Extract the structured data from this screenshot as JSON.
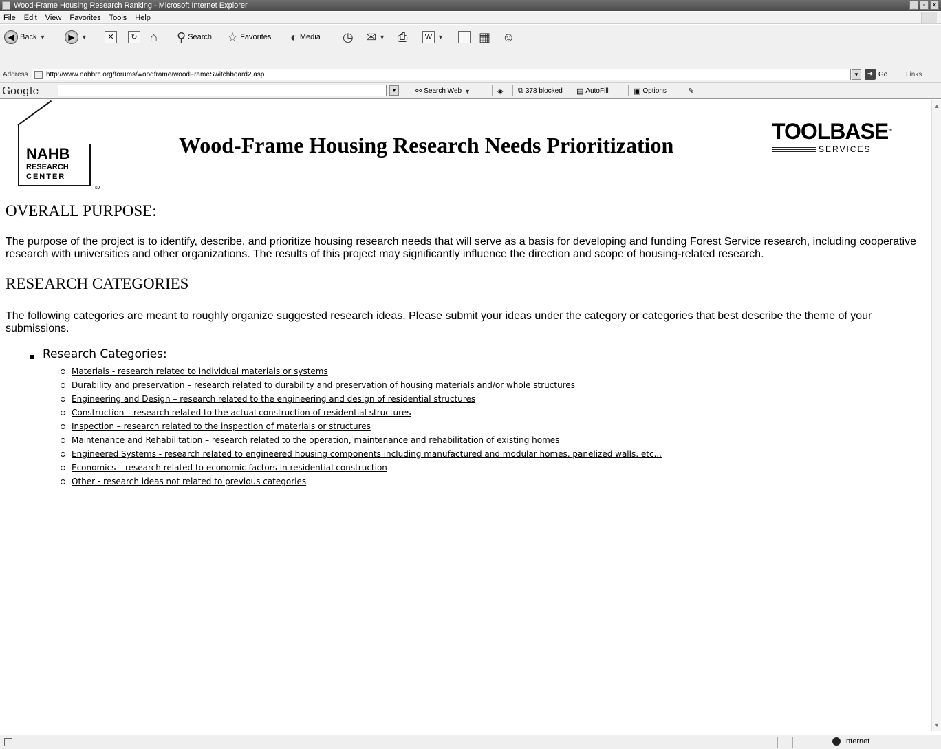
{
  "window": {
    "title": "Wood-Frame Housing Research Ranking - Microsoft Internet Explorer",
    "buttons": [
      "_",
      "▫",
      "✕"
    ]
  },
  "menu": [
    "File",
    "Edit",
    "View",
    "Favorites",
    "Tools",
    "Help"
  ],
  "toolbar": {
    "back_label": "Back",
    "search_label": "Search",
    "favorites_label": "Favorites",
    "media_label": "Media"
  },
  "address": {
    "label": "Address",
    "url": "http://www.nahbrc.org/forums/woodframe/woodFrameSwitchboard2.asp",
    "go_label": "Go",
    "links_label": "Links"
  },
  "google": {
    "logo": "Google",
    "search_web_label": "Search Web",
    "blocked_label": "378 blocked",
    "autofill_label": "AutoFill",
    "options_label": "Options"
  },
  "page": {
    "logo_left": {
      "line1": "NAHB",
      "line2": "RESEARCH",
      "line3": "CENTER",
      "tm": "SM"
    },
    "title": "Wood-Frame Housing Research Needs Prioritization",
    "logo_right": {
      "line1": "TOOLBASE",
      "line2": "SERVICES",
      "tm": "™"
    },
    "purpose_heading": "OVERALL PURPOSE:",
    "purpose_text": "The purpose of the project is to identify, describe, and prioritize housing research needs that will serve as a basis for developing and funding Forest Service research, including cooperative research with universities and other organizations. The results of this project may significantly influence the direction and scope of housing-related research.",
    "categories_heading": "RESEARCH CATEGORIES",
    "categories_text": "The following categories are meant to roughly organize suggested research ideas. Please submit your ideas under the category or categories that best describe the theme of your submissions.",
    "categories_list_title": "Research Categories:",
    "categories": [
      "Materials - research related to individual materials or systems",
      "Durability and preservation – research related to durability and preservation of housing materials and/or whole structures",
      "Engineering and Design – research related to the engineering and design of residential structures",
      "Construction – research related to the actual construction of residential structures",
      "Inspection – research related to the inspection of materials or structures",
      "Maintenance and Rehabilitation – research related to the operation, maintenance and rehabilitation of existing homes",
      "Engineered Systems - research related to engineered housing components including manufactured and modular homes, panelized walls, etc...",
      "Economics – research related to economic factors in residential construction",
      "Other - research ideas not related to previous categories"
    ]
  },
  "status": {
    "zone_label": "Internet"
  }
}
